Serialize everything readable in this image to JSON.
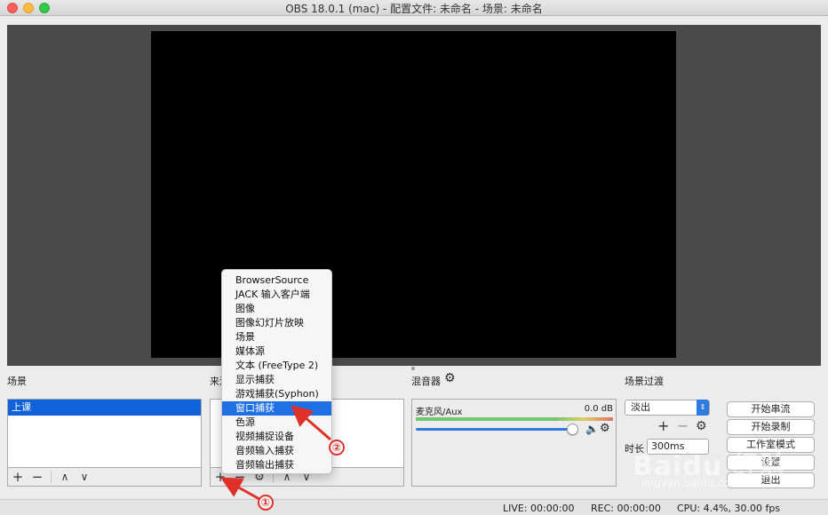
{
  "window": {
    "title": "OBS 18.0.1 (mac) - 配置文件: 未命名 - 场景: 未命名"
  },
  "panels": {
    "scenes_label": "场景",
    "sources_label": "来源",
    "mixer_label": "混音器",
    "transitions_label": "场景过渡"
  },
  "scenes": {
    "items": [
      "上课"
    ]
  },
  "context_menu": {
    "items": [
      "BrowserSource",
      "JACK 输入客户端",
      "图像",
      "图像幻灯片放映",
      "场景",
      "媒体源",
      "文本 (FreeType 2)",
      "显示捕获",
      "游戏捕获(Syphon)",
      "窗口捕获",
      "色源",
      "视频捕捉设备",
      "音频输入捕获",
      "音频输出捕获"
    ],
    "highlighted": "窗口捕获"
  },
  "mixer": {
    "channel_name": "麦克风/Aux",
    "level": "0.0 dB",
    "volume": 0.98
  },
  "transitions": {
    "selected": "淡出",
    "duration_label": "时长",
    "duration_value": "300ms"
  },
  "controls": {
    "start_stream": "开始串流",
    "start_record": "开始录制",
    "studio_mode": "工作室模式",
    "settings": "设置",
    "exit": "退出"
  },
  "status": {
    "live": "LIVE: 00:00:00",
    "rec": "REC: 00:00:00",
    "cpu": "CPU: 4.4%, 30.00 fps"
  },
  "annotations": {
    "step1": "①",
    "step2": "②"
  },
  "watermark": {
    "text": "Baidu 经验",
    "sub": "jingyan.baidu.com"
  },
  "icons": {
    "plus": "+",
    "minus": "−",
    "up": "∧",
    "down": "∨",
    "gear": "⚙",
    "speaker": "🔈",
    "select_arrow": "⇕"
  },
  "colors": {
    "selection": "#0f62d9",
    "menu_highlight": "#1f6fe5",
    "annotation": "#e0302a"
  }
}
